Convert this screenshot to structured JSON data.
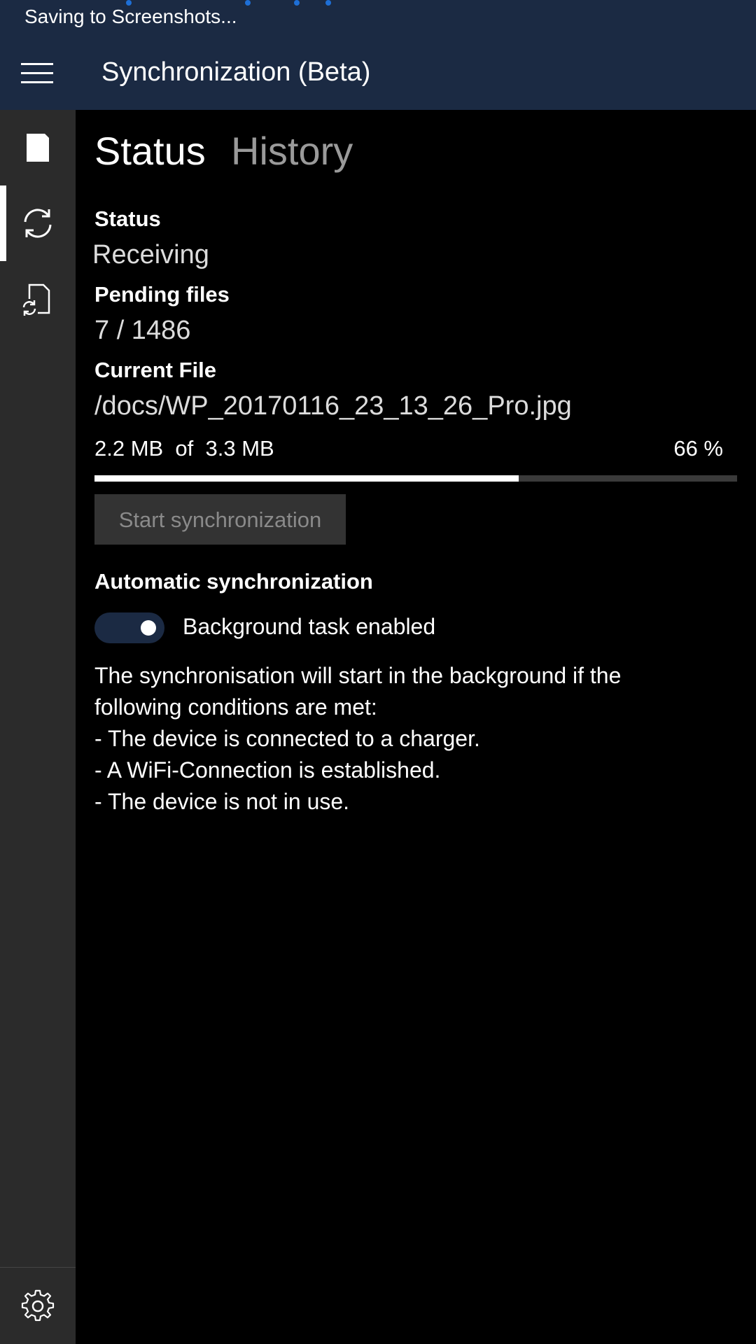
{
  "system": {
    "saving_text": "Saving to Screenshots..."
  },
  "header": {
    "title": "Synchronization (Beta)",
    "background_color": "#1b2a43"
  },
  "rail": {
    "items": [
      {
        "icon": "document-icon",
        "active": false
      },
      {
        "icon": "sync-icon",
        "active": true
      },
      {
        "icon": "sync-file-icon",
        "active": false
      }
    ],
    "settings_icon": "gear-icon"
  },
  "tabs": [
    {
      "label": "Status",
      "selected": true
    },
    {
      "label": "History",
      "selected": false
    }
  ],
  "status": {
    "label": "Status",
    "value": "Receiving"
  },
  "pending": {
    "label": "Pending files",
    "value": "7 / 1486"
  },
  "current_file": {
    "label": "Current File",
    "value": "/docs/WP_20170116_23_13_26_Pro.jpg",
    "transferred": "2.2 MB  of  3.3 MB",
    "percent_text": "66 %",
    "progress_fraction": 0.66
  },
  "start_button": {
    "label": "Start synchronization",
    "enabled": false
  },
  "auto_sync": {
    "label": "Automatic synchronization",
    "toggle_on": true,
    "toggle_label": "Background task enabled"
  },
  "description": {
    "lines": [
      "The synchronisation will start in the background if the",
      "following conditions are met:",
      "- The device is connected to a charger.",
      "- A WiFi-Connection is established.",
      "- The device is not in use."
    ]
  }
}
